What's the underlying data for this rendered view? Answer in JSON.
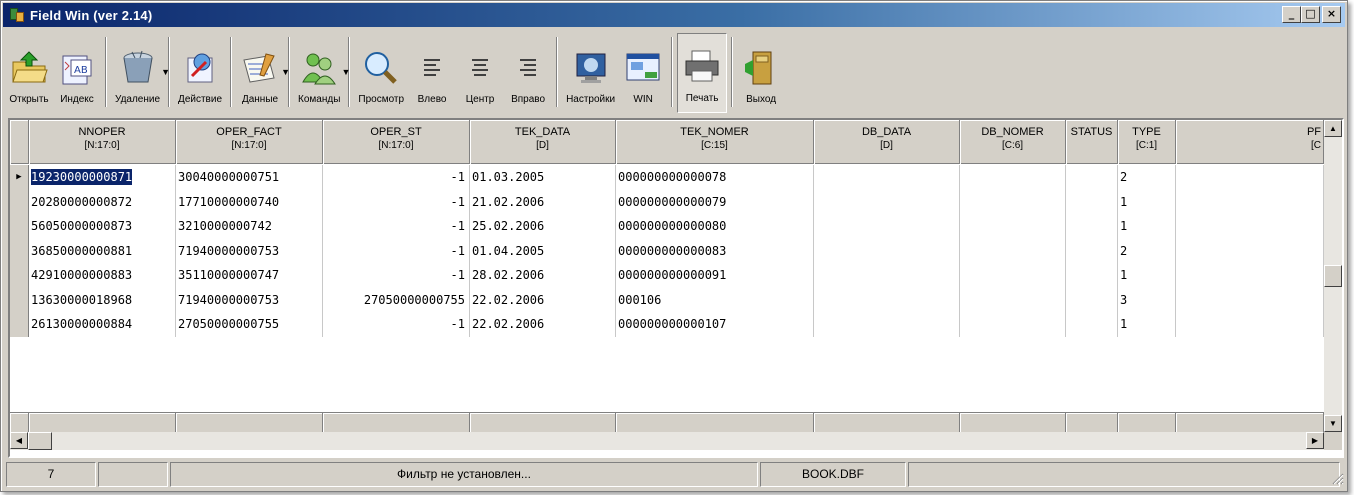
{
  "window": {
    "title": "Field Win (ver 2.14)",
    "buttons": {
      "minimize": "_",
      "maximize": "□",
      "close": "×"
    }
  },
  "toolbar": {
    "items": [
      {
        "label": "Открыть",
        "icon": "open-folder-icon"
      },
      {
        "label": "Индекс",
        "icon": "index-icon"
      },
      {
        "label": "Удаление",
        "icon": "delete-bin-icon"
      },
      {
        "label": "Действие",
        "icon": "action-icon"
      },
      {
        "label": "Данные",
        "icon": "data-icon"
      },
      {
        "label": "Команды",
        "icon": "commands-icon"
      },
      {
        "label": "Просмотр",
        "icon": "magnifier-icon"
      },
      {
        "label": "Влево",
        "icon": "align-left-icon"
      },
      {
        "label": "Центр",
        "icon": "align-center-icon"
      },
      {
        "label": "Вправо",
        "icon": "align-right-icon"
      },
      {
        "label": "Настройки",
        "icon": "settings-monitor-icon"
      },
      {
        "label": "WIN",
        "icon": "win-icon"
      },
      {
        "label": "Печать",
        "icon": "printer-icon"
      },
      {
        "label": "Выход",
        "icon": "exit-door-icon"
      }
    ]
  },
  "grid": {
    "columns": [
      {
        "name": "NNOPER",
        "type": "[N:17:0]"
      },
      {
        "name": "OPER_FACT",
        "type": "[N:17:0]"
      },
      {
        "name": "OPER_ST",
        "type": "[N:17:0]"
      },
      {
        "name": "TEK_DATA",
        "type": "[D]"
      },
      {
        "name": "TEK_NOMER",
        "type": "[C:15]"
      },
      {
        "name": "DB_DATA",
        "type": "[D]"
      },
      {
        "name": "DB_NOMER",
        "type": "[C:6]"
      },
      {
        "name": "STATUS",
        "type": ""
      },
      {
        "name": "TYPE",
        "type": "[C:1]"
      },
      {
        "name": "PF",
        "type": "[C"
      }
    ],
    "rows": [
      [
        "19230000000871",
        "30040000000751",
        "-1",
        "01.03.2005",
        "000000000000078",
        "",
        "",
        "",
        "2",
        ""
      ],
      [
        "20280000000872",
        "17710000000740",
        "-1",
        "21.02.2006",
        "000000000000079",
        "",
        "",
        "",
        "1",
        ""
      ],
      [
        "56050000000873",
        "3210000000742",
        "-1",
        "25.02.2006",
        "000000000000080",
        "",
        "",
        "",
        "1",
        ""
      ],
      [
        "36850000000881",
        "71940000000753",
        "-1",
        "01.04.2005",
        "000000000000083",
        "",
        "",
        "",
        "2",
        ""
      ],
      [
        "42910000000883",
        "35110000000747",
        "-1",
        "28.02.2006",
        "000000000000091",
        "",
        "",
        "",
        "1",
        ""
      ],
      [
        "13630000018968",
        "71940000000753",
        "27050000000755",
        "22.02.2006",
        "000106",
        "",
        "",
        "",
        "3",
        ""
      ],
      [
        "26130000000884",
        "27050000000755",
        "-1",
        "22.02.2006",
        "000000000000107",
        "",
        "",
        "",
        "1",
        ""
      ]
    ],
    "selected_row": 0
  },
  "statusbar": {
    "record_count": "7",
    "empty": "",
    "filter": "Фильтр не установлен...",
    "file": "BOOK.DBF",
    "extra": ""
  },
  "colors": {
    "title_start": "#0a246a",
    "title_end": "#a6caf0",
    "face": "#d4d0c8",
    "selection": "#0a246a"
  }
}
